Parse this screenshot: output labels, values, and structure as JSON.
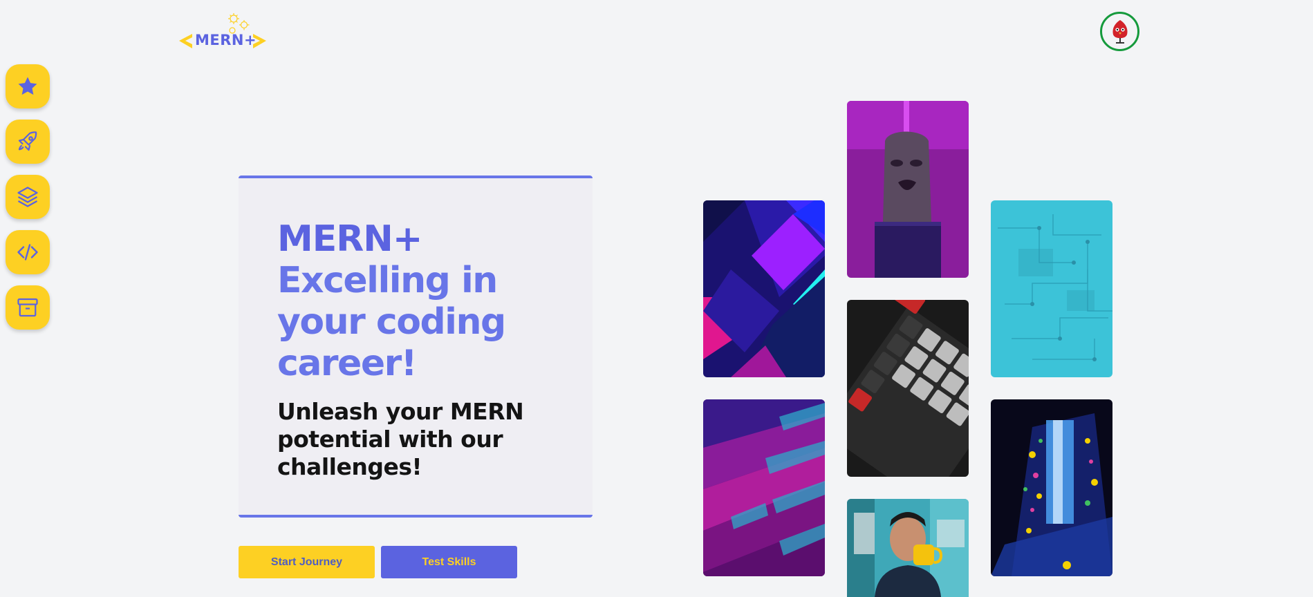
{
  "header": {
    "logo_text": "MERN+",
    "avatar_icon": "red-bird-avatar-icon"
  },
  "sidebar": {
    "items": [
      {
        "icon": "star-icon"
      },
      {
        "icon": "rocket-icon"
      },
      {
        "icon": "layers-icon"
      },
      {
        "icon": "code-icon"
      },
      {
        "icon": "archive-box-icon"
      }
    ]
  },
  "hero": {
    "brand": "MERN+",
    "title_line1": "Excelling in",
    "title_line2": "your coding",
    "title_line3": "career!",
    "subtitle_line1": "Unleash your MERN",
    "subtitle_line2": "potential with our",
    "subtitle_line3": "challenges!"
  },
  "buttons": {
    "start": "Start Journey",
    "test": "Test Skills"
  },
  "gallery": {
    "images": [
      "abstract-purple-diamonds",
      "moai-head-sculpture",
      "circuit-board",
      "mechanical-keyboard",
      "purple-building-facade",
      "waterfall-light-installation",
      "man-drinking-coffee"
    ]
  },
  "colors": {
    "primary": "#5b63e0",
    "accent": "#fdd023",
    "background": "#f3f4f6",
    "text": "#141414"
  }
}
